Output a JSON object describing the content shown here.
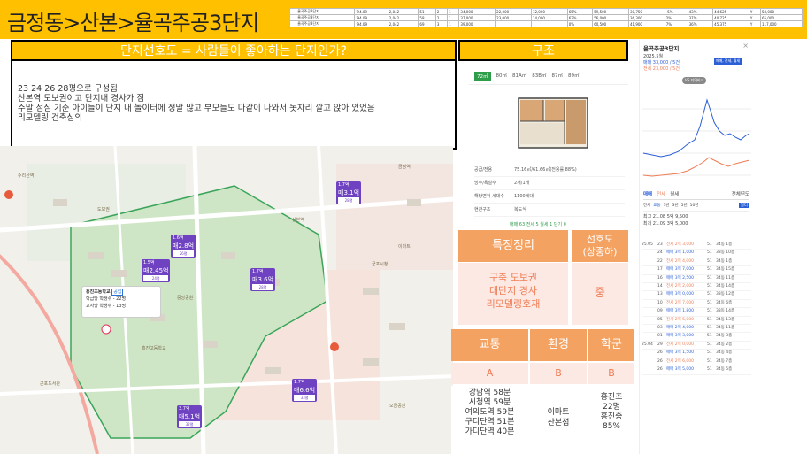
{
  "title": "금정동>산본>율곡주공3단지",
  "mini_table": {
    "rows": [
      [
        "",
        "율곡주공3단지",
        "'94.09",
        "2,042",
        "51",
        "2",
        "1",
        "34,000",
        "22,000",
        "12,000",
        "65%",
        "59,500",
        "30,750",
        "-5%",
        "43%",
        "44,625",
        "Y",
        "58,000"
      ],
      [
        "",
        "율곡주공3단지",
        "'94.09",
        "2,042",
        "58",
        "2",
        "1",
        "37,000",
        "23,000",
        "14,000",
        "62%",
        "56,000",
        "36,300",
        "2%",
        "37%",
        "40,725",
        "Y",
        "65,000"
      ],
      [
        "",
        "율곡주공3단지",
        "'94.09",
        "2,042",
        "69",
        "3",
        "1",
        "39,000",
        "",
        "",
        "0%",
        "60,500",
        "41,900",
        "7%",
        "36%",
        "45,375",
        "Y",
        "117,000"
      ]
    ]
  },
  "preference_header": "단지선호도 = 사람들이 좋아하는 단지인가?",
  "structure_header": "구조",
  "description_lines": [
    "23 24 26 28평으로 구성됨",
    "산본역 도보권이고 단지내 경사가 짐",
    "주말 점심 기준 아이들이 단지 내 놀이터에 정말 많고 부모들도 다같이 나와서 돗자리 깔고 앉아 있었음",
    "리모델링 건축심의"
  ],
  "map": {
    "pins": [
      {
        "price": "매3.1억",
        "tag": "28평",
        "sub": "1.7억"
      },
      {
        "price": "매2.8억",
        "tag": "26평",
        "sub": "1.6억"
      },
      {
        "price": "매2.45억",
        "tag": "24평",
        "sub": "1.5억"
      },
      {
        "price": "매3.6억",
        "tag": "28평",
        "sub": "1.7억"
      },
      {
        "price": "매6.6억",
        "tag": "33평",
        "sub": "1.7억"
      },
      {
        "price": "매5.1억",
        "tag": "32평",
        "sub": "3.7억"
      }
    ],
    "school": {
      "name": "흥진초등학교",
      "badge": "공립",
      "line1": "학급당 학생수 - 22명",
      "line2": "교사당 학생수 - 13명"
    },
    "labels": [
      "도보권",
      "수리산역",
      "금정역",
      "흥진고등학교",
      "근포도서관",
      "산본역",
      "군포시청",
      "중앙공원",
      "오금공원",
      "이마트"
    ]
  },
  "plan": {
    "tabs": [
      "72㎡",
      "80㎡",
      "81A㎡",
      "83B㎡",
      "87㎡",
      "89㎡"
    ],
    "rows": [
      {
        "k": "공급/전용",
        "v": "75.16㎡/61.66㎡(전용률 88%)"
      },
      {
        "k": "방수/욕실수",
        "v": "2개/1개"
      },
      {
        "k": "해당면적 세대수",
        "v": "1100세대"
      },
      {
        "k": "현관구조",
        "v": "복도식"
      }
    ],
    "footer": "매매 63  전세 5  월세 1  단기 0"
  },
  "right_panel": {
    "title": "율곡주공3단지",
    "date": "2025.5월",
    "sale": "매매 33,000 / 5건",
    "jeonse": "전세 23,000 / 5건",
    "legend": "매매, 전세, 월세",
    "compare": "VS 지역비교",
    "tabs": [
      "매매",
      "전세",
      "월세"
    ],
    "sort": "전체년도",
    "filters": [
      "전체",
      "교통",
      "1년",
      "3년",
      "5년",
      "10년"
    ],
    "high1": "최고 21.08  5억 9,500",
    "high2": "최저 21.09  3억 5,000",
    "trade_rows": [
      [
        "25.05",
        "23",
        "전세 2억 3,000",
        "51",
        "34동 1층"
      ],
      [
        "",
        "24",
        "매매 3억 1,000",
        "51",
        "33동 10층"
      ],
      [
        "",
        "22",
        "전세 2억 4,000",
        "51",
        "34동 1층"
      ],
      [
        "",
        "17",
        "매매 3억 7,000",
        "51",
        "34동 15층"
      ],
      [
        "",
        "16",
        "매매 3억 2,500",
        "51",
        "34동 11층"
      ],
      [
        "",
        "14",
        "전세 2억 2,000",
        "51",
        "34동 14층"
      ],
      [
        "",
        "13",
        "매매 3억 0,000",
        "51",
        "33동 12층"
      ],
      [
        "",
        "10",
        "전세 2억 7,000",
        "51",
        "34동 6층"
      ],
      [
        "",
        "09",
        "매매 3억 1,800",
        "51",
        "33동 14층"
      ],
      [
        "",
        "05",
        "전세 2억 5,000",
        "51",
        "34동 13층"
      ],
      [
        "",
        "03",
        "매매 2억 4,000",
        "51",
        "34동 11층"
      ],
      [
        "",
        "01",
        "매매 3억 3,000",
        "51",
        "34동 3층"
      ],
      [
        "25.04",
        "29",
        "전세 2억 0,000",
        "51",
        "34동 2층"
      ],
      [
        "",
        "26",
        "매매 3억 1,500",
        "51",
        "34동 4층"
      ],
      [
        "",
        "26",
        "전세 2억 6,000",
        "51",
        "34동 7층"
      ],
      [
        "",
        "26",
        "매매 3억 5,000",
        "51",
        "34동 5층"
      ]
    ]
  },
  "features": {
    "h_summary": "특징정리",
    "h_pref": "선호도\n(상중하)",
    "summary": "구축 도보권\n대단지 경사\n리모델링호재",
    "pref": "중",
    "h_traffic": "교통",
    "h_env": "환경",
    "h_school": "학군",
    "g_traffic": "A",
    "g_env": "B",
    "g_school": "B",
    "traffic_text": "강남역 58분\n시청역 59분\n여의도역 59분\n구디단역 51분\n가디단역 40분",
    "env_text": "이마트\n산본점",
    "school_text": "흥진초\n22명\n흥진중\n85%"
  },
  "colors": {
    "accent": "#ffc000",
    "orange": "#f4a261",
    "pink": "#fde9e3",
    "pink_text": "#ef7c54",
    "pin": "#6f42c1",
    "green": "#2e9d4a"
  }
}
